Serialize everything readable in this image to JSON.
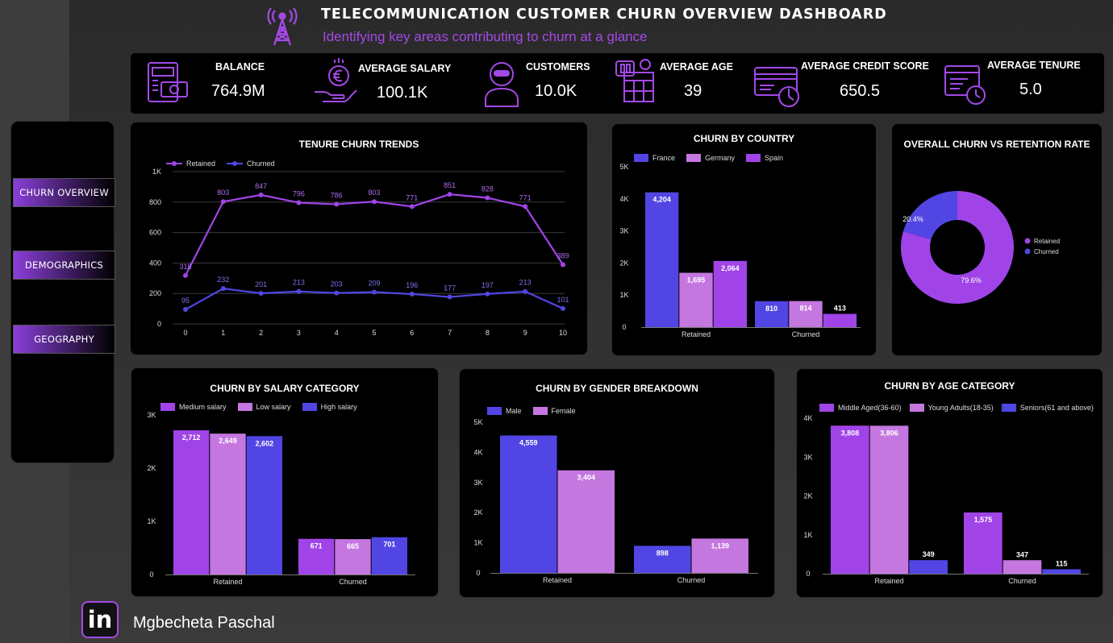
{
  "header": {
    "title": "TELECOMMUNICATION CUSTOMER CHURN OVERVIEW DASHBOARD",
    "subtitle": "Identifying key areas contributing to churn at a glance"
  },
  "colors": {
    "retained": "#a044e8",
    "churned": "#5146e3",
    "lavender": "#c577e0",
    "title_purple": "#a449e8",
    "background": "#000000"
  },
  "kpis": [
    {
      "label": "BALANCE",
      "value": "764.9M",
      "icon": "balance-icon"
    },
    {
      "label": "AVERAGE SALARY",
      "value": "100.1K",
      "icon": "euro-hand-icon"
    },
    {
      "label": "CUSTOMERS",
      "value": "10.0K",
      "icon": "customer-icon"
    },
    {
      "label": "AVERAGE AGE",
      "value": "39",
      "icon": "calendar-icon"
    },
    {
      "label": "AVERAGE CREDIT SCORE",
      "value": "650.5",
      "icon": "credit-card-icon"
    },
    {
      "label": "AVERAGE TENURE",
      "value": "5.0",
      "icon": "tenure-icon"
    }
  ],
  "nav": {
    "items": [
      "CHURN OVERVIEW",
      "DEMOGRAPHICS",
      "GEOGRAPHY"
    ]
  },
  "footer": {
    "author": "Mgbecheta Paschal",
    "logo_text": "in"
  },
  "chart_data": [
    {
      "id": "tenure",
      "type": "line",
      "title": "TENURE CHURN TRENDS",
      "x": [
        0,
        1,
        2,
        3,
        4,
        5,
        6,
        7,
        8,
        9,
        10
      ],
      "series": [
        {
          "name": "Retained",
          "values": [
            318,
            803,
            847,
            796,
            786,
            803,
            771,
            851,
            828,
            771,
            389
          ]
        },
        {
          "name": "Churned",
          "values": [
            95,
            232,
            201,
            213,
            203,
            209,
            196,
            177,
            197,
            213,
            101
          ]
        }
      ],
      "y_ticks": [
        "0",
        "200",
        "400",
        "600",
        "800",
        "1K"
      ],
      "x_tick_labels": [
        "0",
        "1",
        "2",
        "3",
        "4",
        "5",
        "6",
        "7",
        "8",
        "9",
        "10"
      ],
      "point_labels": {
        "Retained": [
          "318",
          "803",
          "847",
          "796",
          "786",
          "803",
          "771",
          "851",
          "828",
          "771",
          "389"
        ],
        "Churned": [
          "95",
          "232",
          "201",
          "213",
          "203",
          "209",
          "196",
          "177",
          "197",
          "213",
          "101"
        ]
      },
      "ylim": [
        0,
        1000
      ],
      "grid": true,
      "legend": "top-left"
    },
    {
      "id": "country",
      "type": "bar",
      "title": "CHURN BY COUNTRY",
      "categories": [
        "Retained",
        "Churned"
      ],
      "series": [
        {
          "name": "France",
          "values": [
            4204,
            810
          ],
          "labels": [
            "4,204",
            "810"
          ]
        },
        {
          "name": "Germany",
          "values": [
            1695,
            814
          ],
          "labels": [
            "1,695",
            "814"
          ]
        },
        {
          "name": "Spain",
          "values": [
            2064,
            413
          ],
          "labels": [
            "2,064",
            "413"
          ]
        }
      ],
      "y_ticks": [
        "0",
        "1K",
        "2K",
        "3K",
        "4K",
        "5K"
      ],
      "ylim": [
        0,
        5000
      ],
      "legend": "top-left"
    },
    {
      "id": "donut",
      "type": "pie",
      "title": "OVERALL CHURN VS RETENTION RATE",
      "slices": [
        {
          "name": "Retained",
          "value": 79.6,
          "label": "79.6%"
        },
        {
          "name": "Churned",
          "value": 20.4,
          "label": "20.4%"
        }
      ],
      "legend": "right"
    },
    {
      "id": "salary",
      "type": "bar",
      "title": "CHURN BY SALARY CATEGORY",
      "categories": [
        "Retained",
        "Churned"
      ],
      "series": [
        {
          "name": "Medium salary",
          "values": [
            2712,
            671
          ],
          "labels": [
            "2,712",
            "671"
          ]
        },
        {
          "name": "Low salary",
          "values": [
            2649,
            665
          ],
          "labels": [
            "2,649",
            "665"
          ]
        },
        {
          "name": "High salary",
          "values": [
            2602,
            701
          ],
          "labels": [
            "2,602",
            "701"
          ]
        }
      ],
      "y_ticks": [
        "0",
        "1K",
        "2K",
        "3K"
      ],
      "ylim": [
        0,
        3000
      ],
      "legend": "top-left"
    },
    {
      "id": "gender",
      "type": "bar",
      "title": "CHURN BY GENDER BREAKDOWN",
      "categories": [
        "Retained",
        "Churned"
      ],
      "series": [
        {
          "name": "Male",
          "values": [
            4559,
            898
          ],
          "labels": [
            "4,559",
            "898"
          ]
        },
        {
          "name": "Female",
          "values": [
            3404,
            1139
          ],
          "labels": [
            "3,404",
            "1,139"
          ]
        }
      ],
      "y_ticks": [
        "0",
        "1K",
        "2K",
        "3K",
        "4K",
        "5K"
      ],
      "ylim": [
        0,
        5000
      ],
      "legend": "top-left"
    },
    {
      "id": "age",
      "type": "bar",
      "title": "CHURN BY AGE CATEGORY",
      "categories": [
        "Retained",
        "Churned"
      ],
      "series": [
        {
          "name": "Middle Aged(36-60)",
          "values": [
            3808,
            1575
          ],
          "labels": [
            "3,808",
            "1,575"
          ]
        },
        {
          "name": "Young Adults(18-35)",
          "values": [
            3806,
            347
          ],
          "labels": [
            "3,806",
            "347"
          ]
        },
        {
          "name": "Seniors(61 and above)",
          "values": [
            349,
            115
          ],
          "labels": [
            "349",
            "115"
          ]
        }
      ],
      "y_ticks": [
        "0",
        "1K",
        "2K",
        "3K",
        "4K"
      ],
      "ylim": [
        0,
        4000
      ],
      "legend": "top-left"
    }
  ]
}
